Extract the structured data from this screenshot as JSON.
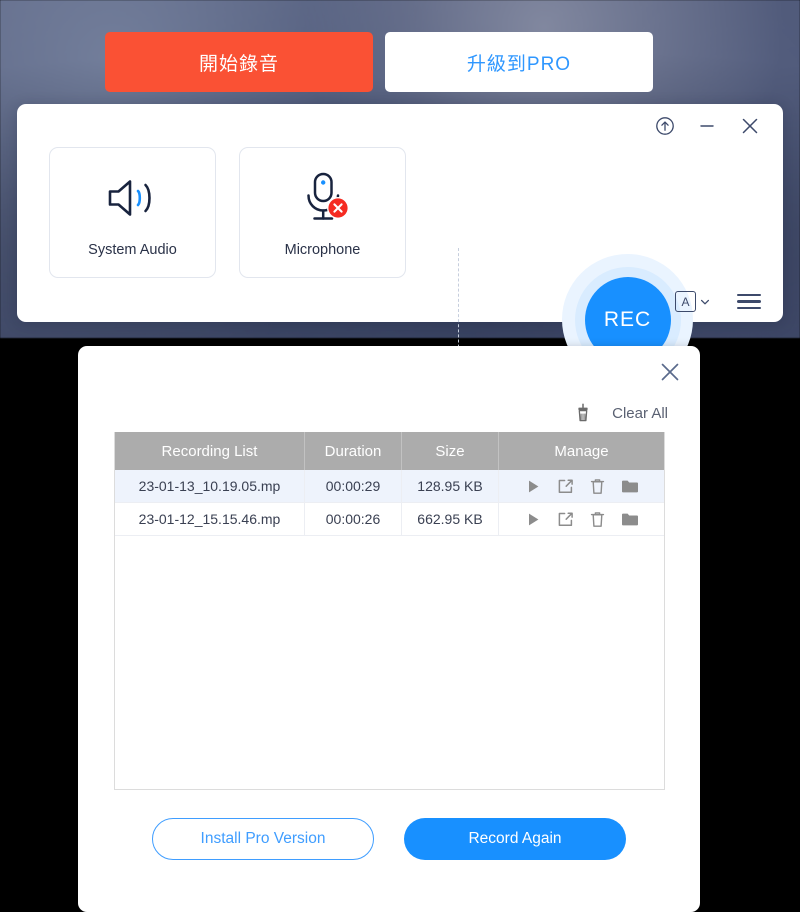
{
  "top_actions": {
    "start_record_label": "開始錄音",
    "upgrade_pro_label": "升級到PRO",
    "start_record_color": "#fa5134",
    "upgrade_pro_color": "#2f97ff"
  },
  "recorder_panel": {
    "window_controls": {
      "pin_icon": "arrow-up-circle-icon",
      "minimize_icon": "minimize-icon",
      "close_icon": "close-icon"
    },
    "sources": [
      {
        "label": "System Audio",
        "icon": "speaker-icon",
        "enabled": true
      },
      {
        "label": "Microphone",
        "icon": "microphone-icon",
        "enabled": false,
        "badge": "disabled-x-badge"
      }
    ],
    "rec_button_label": "REC",
    "rec_button_color": "#1890ff",
    "format_selector": {
      "icon": "letter-a-box-icon",
      "caret": "chevron-down-icon"
    },
    "menu_icon": "hamburger-menu-icon"
  },
  "recordings_panel": {
    "close_icon": "close-icon",
    "clear_all_label": "Clear All",
    "clear_all_icon": "broom-icon",
    "table": {
      "columns": [
        "Recording List",
        "Duration",
        "Size",
        "Manage"
      ],
      "rows": [
        {
          "name": "23-01-13_10.19.05.mp",
          "duration": "00:00:29",
          "size": "128.95 KB",
          "selected": true
        },
        {
          "name": "23-01-12_15.15.46.mp",
          "duration": "00:00:26",
          "size": "662.95 KB",
          "selected": false
        }
      ],
      "manage_icons": [
        "play-icon",
        "edit-icon",
        "trash-icon",
        "folder-icon"
      ]
    },
    "footer": {
      "install_pro_label": "Install Pro Version",
      "record_again_label": "Record Again",
      "install_pro_color": "#3f9dff",
      "record_again_color": "#1890ff"
    }
  }
}
